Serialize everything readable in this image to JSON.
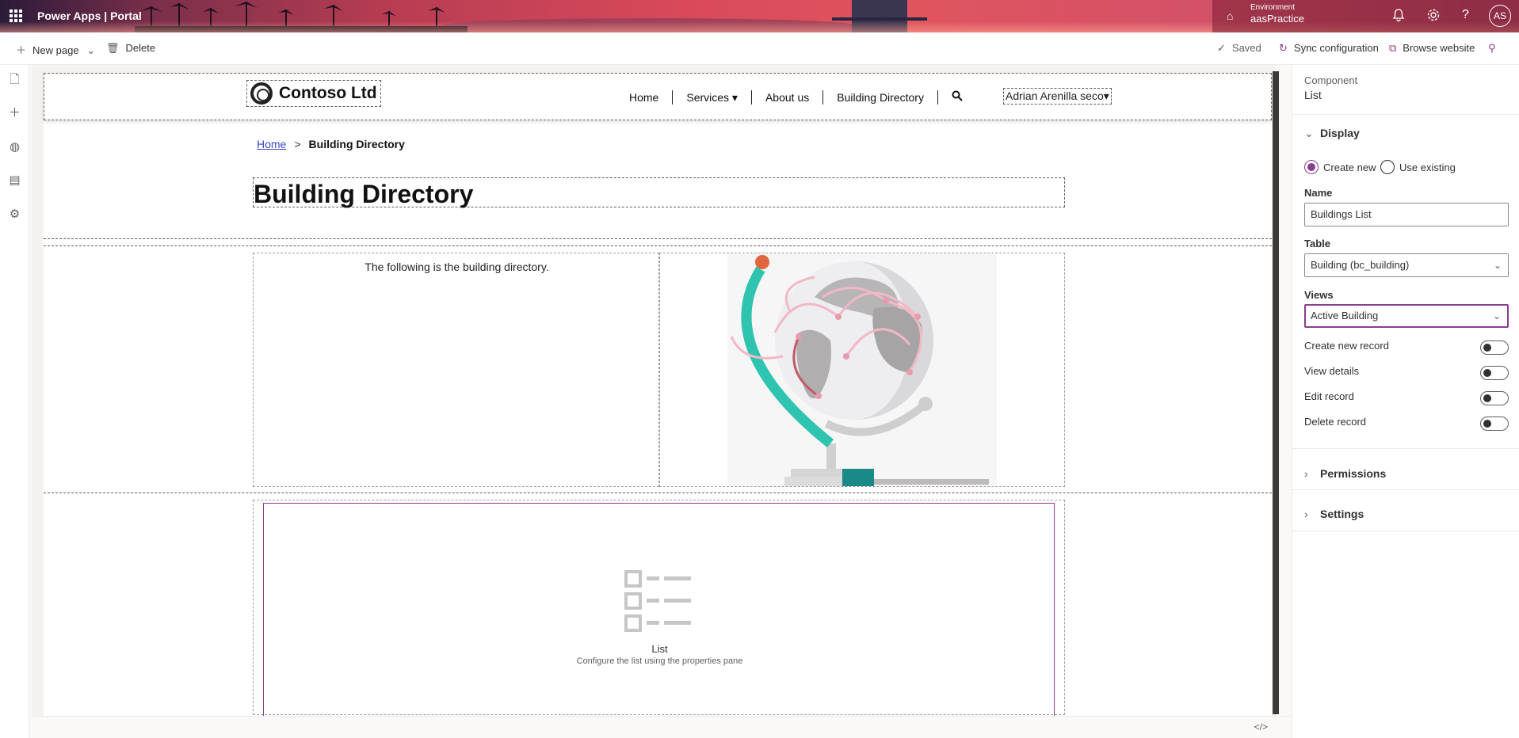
{
  "topbar": {
    "app_title": "Power Apps  |  Portal",
    "environment_label": "Environment",
    "environment_name": "aasPractice",
    "avatar_initials": "AS"
  },
  "commandbar": {
    "new_page": "New page",
    "delete": "Delete",
    "saved": "Saved",
    "sync": "Sync configuration",
    "browse": "Browse website"
  },
  "site": {
    "logo_text": "Contoso Ltd",
    "nav": [
      "Home",
      "Services ▾",
      "About us",
      "Building Directory"
    ],
    "user": "Adrian Arenilla seco▾",
    "breadcrumb": {
      "home": "Home",
      "separator": ">",
      "current": "Building Directory"
    },
    "title": "Building Directory",
    "intro_text": "The following is the building directory.",
    "list_placeholder": {
      "title": "List",
      "subtitle": "Configure the list using the properties pane"
    }
  },
  "panel": {
    "kicker": "Component",
    "component_name": "List",
    "display": {
      "header": "Display",
      "radio_create": "Create new",
      "radio_existing": "Use existing",
      "selected": "Create new",
      "name_label": "Name",
      "name_value": "Buildings List",
      "table_label": "Table",
      "table_value": "Building (bc_building)",
      "views_label": "Views",
      "views_value": "Active Building",
      "toggles": [
        {
          "label": "Create new record",
          "on": false
        },
        {
          "label": "View details",
          "on": false
        },
        {
          "label": "Edit record",
          "on": false
        },
        {
          "label": "Delete record",
          "on": false
        }
      ]
    },
    "permissions": "Permissions",
    "settings": "Settings"
  },
  "colors": {
    "accent": "#8a3c8e",
    "link": "#3b47c9"
  }
}
